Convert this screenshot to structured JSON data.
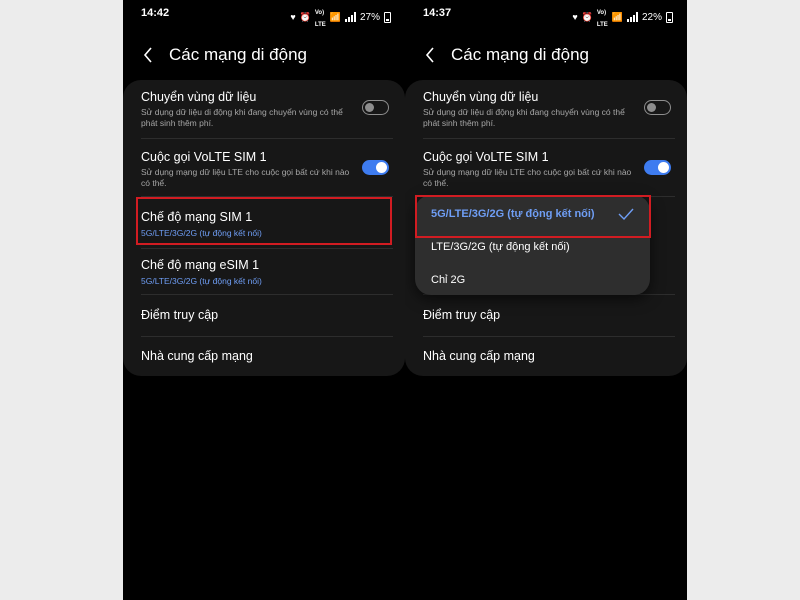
{
  "left": {
    "status": {
      "time": "14:42",
      "battery": "27%"
    },
    "header": {
      "title": "Các mạng di động"
    },
    "items": [
      {
        "title": "Chuyển vùng dữ liệu",
        "desc": "Sử dụng dữ liệu di động khi đang chuyển vùng có thể phát sinh thêm phí."
      },
      {
        "title": "Cuộc gọi VoLTE SIM 1",
        "desc": "Sử dụng mạng dữ liệu LTE cho cuộc gọi bất cứ khi nào có thể."
      },
      {
        "title": "Chế độ mạng SIM 1",
        "value": "5G/LTE/3G/2G (tự động kết nối)"
      },
      {
        "title": "Chế độ mạng eSIM 1",
        "value": "5G/LTE/3G/2G (tự động kết nối)"
      },
      {
        "title": "Điểm truy cập"
      },
      {
        "title": "Nhà cung cấp mạng"
      }
    ],
    "toggles": {
      "roaming": false,
      "volte": true
    }
  },
  "right": {
    "status": {
      "time": "14:37",
      "battery": "22%"
    },
    "header": {
      "title": "Các mạng di động"
    },
    "items": [
      {
        "title": "Chuyển vùng dữ liệu",
        "desc": "Sử dụng dữ liệu di động khi đang chuyển vùng có thể phát sinh thêm phí."
      },
      {
        "title": "Cuộc gọi VoLTE SIM 1",
        "desc": "Sử dụng mạng dữ liệu LTE cho cuộc gọi bất cứ khi nào có thể."
      },
      {
        "title": "Điểm truy cập"
      },
      {
        "title": "Nhà cung cấp mạng"
      }
    ],
    "toggles": {
      "roaming": false,
      "volte": true
    },
    "network_mode_options": [
      {
        "label": "5G/LTE/3G/2G (tự động kết nối)",
        "selected": true
      },
      {
        "label": "LTE/3G/2G (tự động kết nối)",
        "selected": false
      },
      {
        "label": "Chỉ 2G",
        "selected": false
      }
    ]
  },
  "colors": {
    "accent": "#3e7cf0",
    "highlight": "#d11c22",
    "link_text": "#6f9ef5"
  },
  "icons": [
    "back-arrow-icon",
    "heart-icon",
    "alarm-icon",
    "volte-icon",
    "wifi-icon",
    "signal-icon",
    "battery-icon",
    "check-icon"
  ]
}
